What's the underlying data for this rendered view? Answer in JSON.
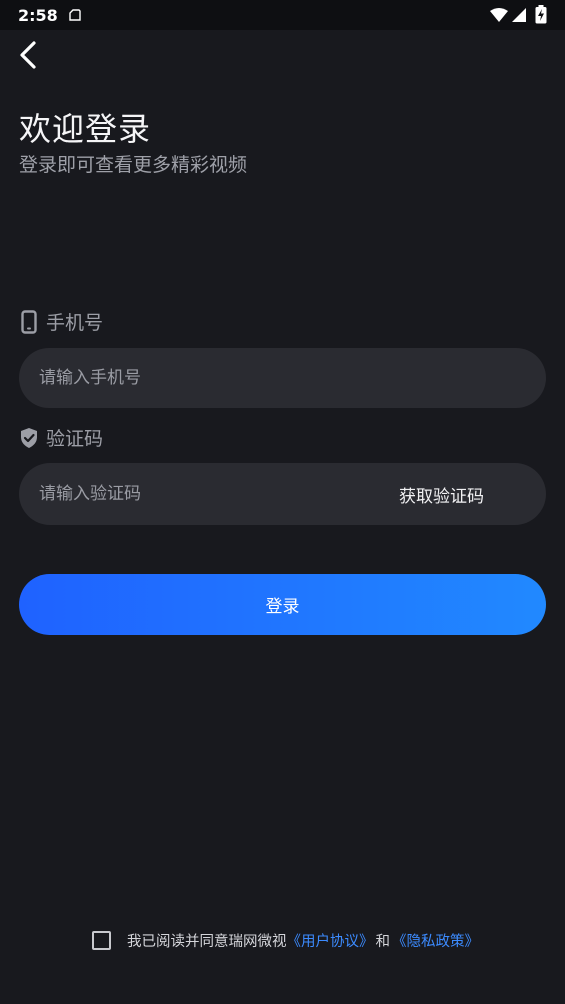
{
  "status_bar": {
    "time": "2:58"
  },
  "header": {
    "title": "欢迎登录",
    "subtitle": "登录即可查看更多精彩视频"
  },
  "phone": {
    "label": "手机号",
    "placeholder": "请输入手机号",
    "value": ""
  },
  "code": {
    "label": "验证码",
    "placeholder": "请输入验证码",
    "value": "",
    "get_code_label": "获取验证码"
  },
  "login": {
    "label": "登录"
  },
  "agreement": {
    "checked": false,
    "text": "我已阅读并同意瑞网微视",
    "user_agreement_link": "《用户协议》",
    "and": "和",
    "privacy_link": "《隐私政策》"
  },
  "colors": {
    "background": "#18191e",
    "input_background": "#2a2b31",
    "primary_gradient_start": "#1f62ff",
    "primary_gradient_end": "#2189ff",
    "link": "#3c8bff"
  }
}
